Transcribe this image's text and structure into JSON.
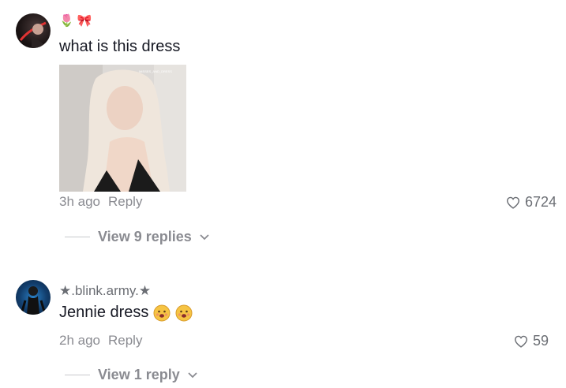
{
  "comments": [
    {
      "username": "",
      "username_emojis": [
        "🌷",
        "🎀"
      ],
      "text": "what is this dress",
      "has_image": true,
      "image_watermark": "MISSES_AND_DRESS",
      "time": "3h ago",
      "reply_label": "Reply",
      "likes": "6724",
      "view_replies": "View 9 replies"
    },
    {
      "username": "★.blink.army.★",
      "text": "Jennie dress",
      "text_emojis": [
        "face-emoji",
        "face-emoji"
      ],
      "time": "2h ago",
      "reply_label": "Reply",
      "likes": "59",
      "view_replies": "View 1 reply"
    }
  ]
}
